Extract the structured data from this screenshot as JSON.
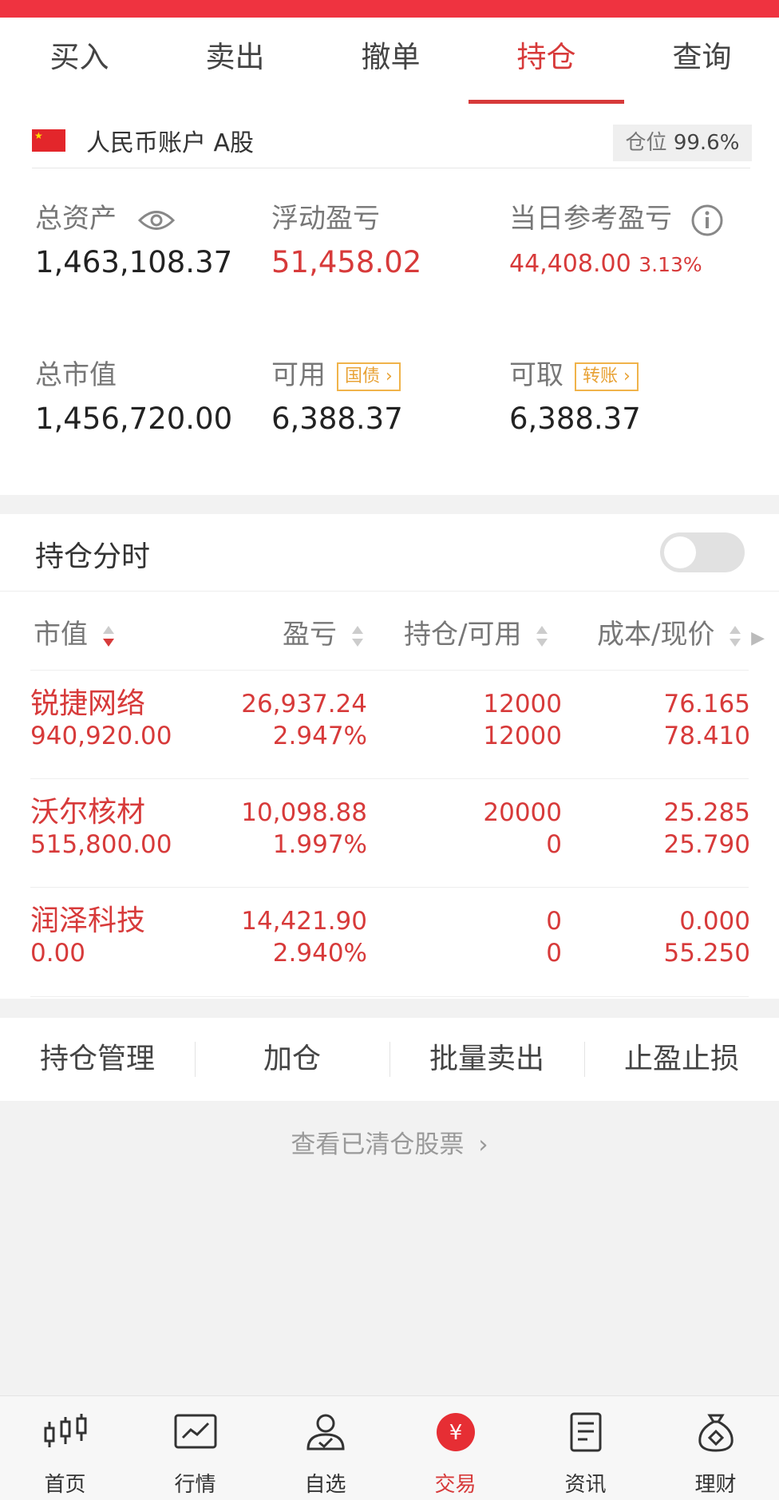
{
  "tabs": [
    "买入",
    "卖出",
    "撤单",
    "持仓",
    "查询"
  ],
  "active_tab": "持仓",
  "account": {
    "label": "人民币账户 A股",
    "position_label": "仓位",
    "position_value": "99.6%"
  },
  "summary": {
    "total_assets_label": "总资产",
    "total_assets": "1,463,108.37",
    "floating_pl_label": "浮动盈亏",
    "floating_pl": "51,458.02",
    "daily_pl_label": "当日参考盈亏",
    "daily_pl": "44,408.00",
    "daily_pl_pct": "3.13%",
    "market_value_label": "总市值",
    "market_value": "1,456,720.00",
    "available_label": "可用",
    "available_tag": "国债",
    "available": "6,388.37",
    "withdrawable_label": "可取",
    "withdrawable_tag": "转账",
    "withdrawable": "6,388.37"
  },
  "holdings_intraday_label": "持仓分时",
  "table": {
    "headers": [
      "市值",
      "盈亏",
      "持仓/可用",
      "成本/现价"
    ],
    "rows": [
      {
        "name": "锐捷网络",
        "market_value": "940,920.00",
        "pl": "26,937.24",
        "pl_pct": "2.947%",
        "position": "12000",
        "available": "12000",
        "cost": "76.165",
        "price": "78.410"
      },
      {
        "name": "沃尔核材",
        "market_value": "515,800.00",
        "pl": "10,098.88",
        "pl_pct": "1.997%",
        "position": "20000",
        "available": "0",
        "cost": "25.285",
        "price": "25.790"
      },
      {
        "name": "润泽科技",
        "market_value": "0.00",
        "pl": "14,421.90",
        "pl_pct": "2.940%",
        "position": "0",
        "available": "0",
        "cost": "0.000",
        "price": "55.250"
      }
    ]
  },
  "actions": [
    "持仓管理",
    "加仓",
    "批量卖出",
    "止盈止损"
  ],
  "cleared_link": "查看已清仓股票",
  "bottom_nav": [
    {
      "label": "首页",
      "icon": "candlestick-icon"
    },
    {
      "label": "行情",
      "icon": "chart-icon"
    },
    {
      "label": "自选",
      "icon": "user-check-icon"
    },
    {
      "label": "交易",
      "icon": "yuan-icon"
    },
    {
      "label": "资讯",
      "icon": "document-icon"
    },
    {
      "label": "理财",
      "icon": "money-bag-icon"
    }
  ],
  "colors": {
    "accent": "#d73a3a",
    "tag": "#e8a235"
  }
}
